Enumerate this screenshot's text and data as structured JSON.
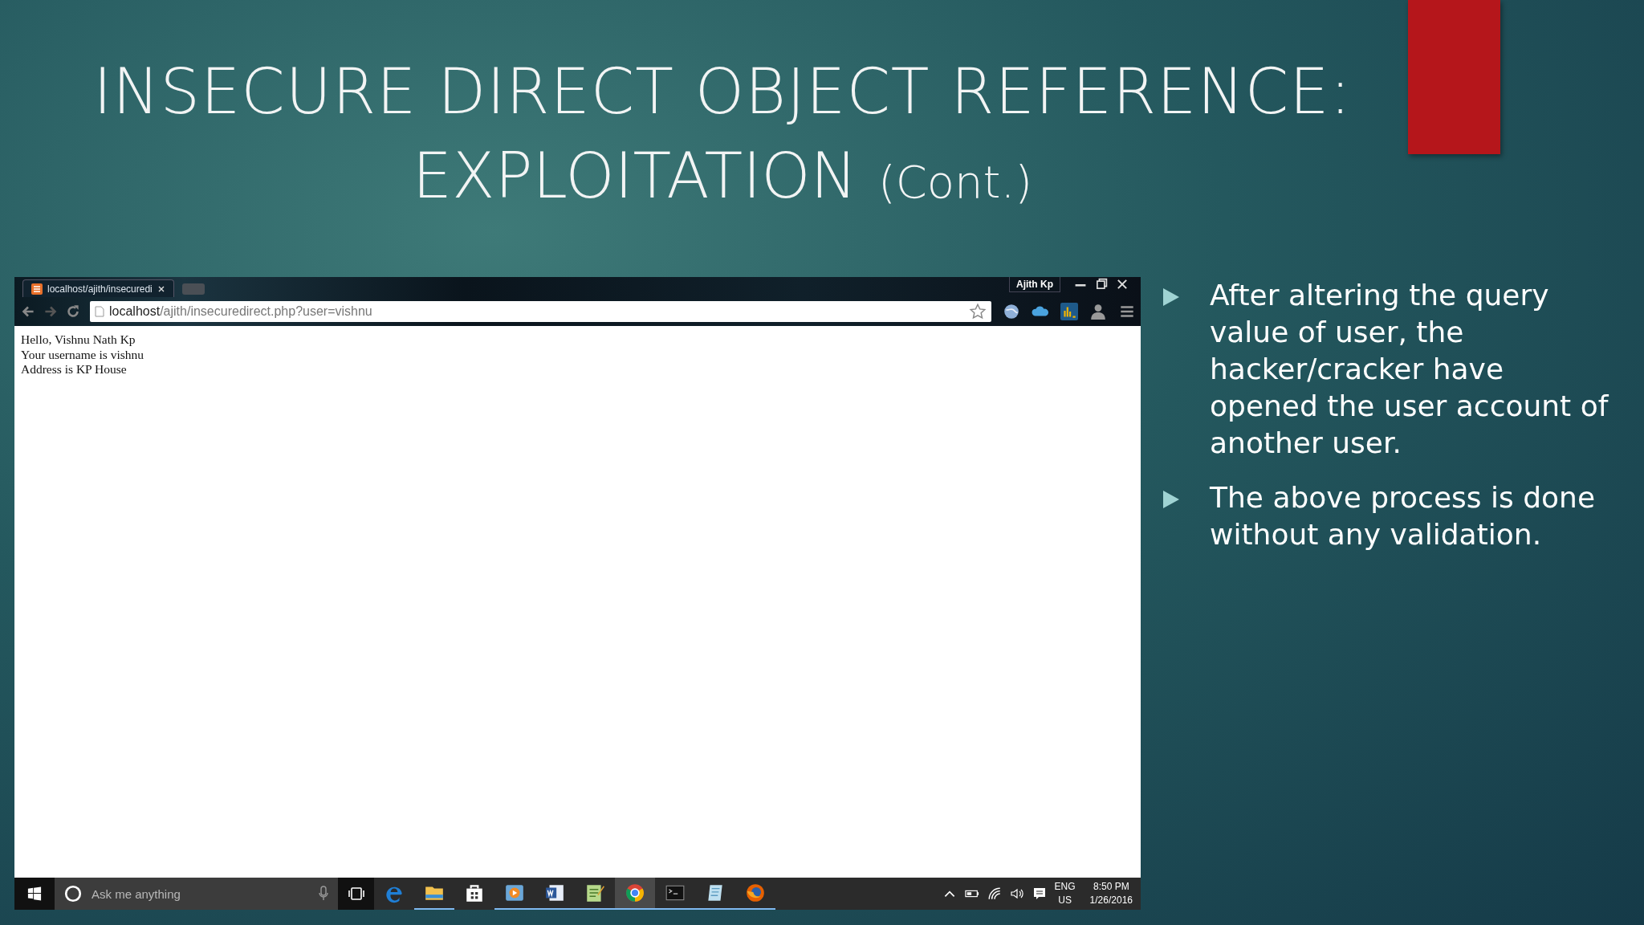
{
  "slide": {
    "title_line_1": "INSECURE DIRECT OBJECT REFERENCE:",
    "title_line_2": "EXPLOITATION",
    "title_suffix": "(Cont.)",
    "bullets": [
      "After altering the query value of user, the hacker/cracker have opened the user account of another user.",
      "The above process is done without any validation."
    ]
  },
  "browser": {
    "tabs": [
      {
        "label": "localhost/ajith/insecuredi",
        "selected": true
      }
    ],
    "profile": "Ajith Kp",
    "address": {
      "host": "localhost",
      "path": "/ajith/insecuredirect.php?user=vishnu"
    },
    "toolbar_icons": [
      {
        "kind": "globe"
      },
      {
        "kind": "cloud"
      },
      {
        "kind": "chart"
      },
      {
        "kind": "person"
      },
      {
        "kind": "menu"
      }
    ],
    "page_lines": [
      "Hello, Vishnu Nath Kp",
      "Your username is vishnu",
      "Address is KP House"
    ]
  },
  "taskbar": {
    "search": {
      "placeholder": "Ask me anything"
    },
    "apps": [
      {
        "kind": "edge",
        "running": false,
        "selected": false
      },
      {
        "kind": "folder",
        "running": true,
        "selected": false
      },
      {
        "kind": "store",
        "running": false,
        "selected": false
      },
      {
        "kind": "media",
        "running": true,
        "selected": false
      },
      {
        "kind": "word",
        "running": true,
        "selected": false
      },
      {
        "kind": "notepad",
        "running": true,
        "selected": false
      },
      {
        "kind": "chrome",
        "running": true,
        "selected": true
      },
      {
        "kind": "terminal",
        "running": true,
        "selected": false
      },
      {
        "kind": "notes",
        "running": true,
        "selected": false
      },
      {
        "kind": "firefox",
        "running": true,
        "selected": false
      }
    ],
    "language": "ENG",
    "region": "US",
    "time": "8:50 PM",
    "date": "1/26/2016"
  }
}
